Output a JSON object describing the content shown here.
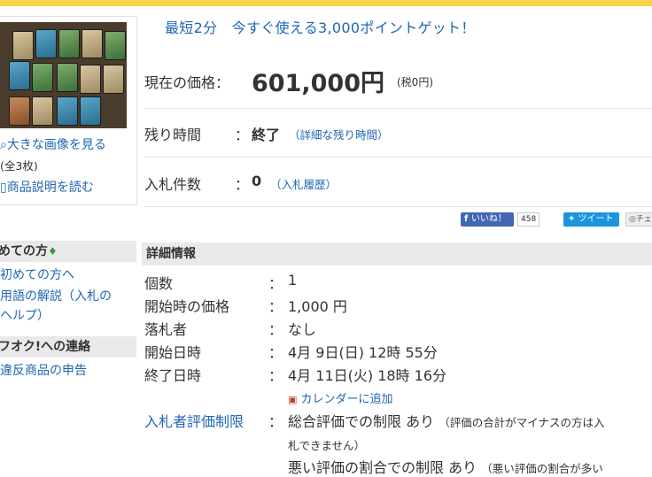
{
  "colors": {
    "top_bar": "#f7d24a",
    "link": "#2066b3",
    "section_bg": "#e9e9e9",
    "facebook": "#4267b2",
    "twitter": "#1b95e0"
  },
  "left": {
    "view_large": "大きな画像を見る",
    "image_count": "(全3枚)",
    "read_description": "商品説明を読む",
    "beginners_heading": "めての方",
    "beginners_link": "初めての方へ",
    "glossary_line1": "用語の解説（入札の",
    "glossary_line2": "ヘルプ）",
    "contact_heading": "フオク!への連絡",
    "report_link": "違反商品の申告"
  },
  "promo": "最短2分　今すぐ使える3,000ポイントゲット！",
  "price": {
    "label": "現在の価格：",
    "value": "601,000円",
    "tax": "(税0円)"
  },
  "time_left": {
    "label": "残り時間",
    "colon": "：",
    "value": "終了",
    "detail_link": "（詳細な残り時間）"
  },
  "bids": {
    "label": "入札件数",
    "colon": "：",
    "value": "0",
    "history_link": "（入札履歴）"
  },
  "social": {
    "like": "いいね！",
    "like_count": "458",
    "tweet": "ツイート",
    "check": "チェ"
  },
  "details": {
    "heading": "詳細情報",
    "rows": [
      {
        "label": "個数",
        "colon": "：",
        "value": "1"
      },
      {
        "label": "開始時の価格",
        "colon": "：",
        "value": "1,000 円"
      },
      {
        "label": "落札者",
        "colon": "：",
        "value": "なし"
      },
      {
        "label": "開始日時",
        "colon": "：",
        "value": "4月 9日(日) 12時 55分"
      },
      {
        "label": "終了日時",
        "colon": "：",
        "value": "4月 11日(火) 18時 16分"
      }
    ],
    "calendar_link": "カレンダーに追加",
    "bidder_limit_label": "入札者評価制限",
    "bidder_limit_colon": "：",
    "limit1_main": "総合評価での制限 あり",
    "limit1_note_a": "（評価の合計がマイナスの方は入",
    "limit1_note_b": "札できません）",
    "limit2_main": "悪い評価の割合での制限 あり",
    "limit2_note": "（悪い評価の割合が多い"
  }
}
